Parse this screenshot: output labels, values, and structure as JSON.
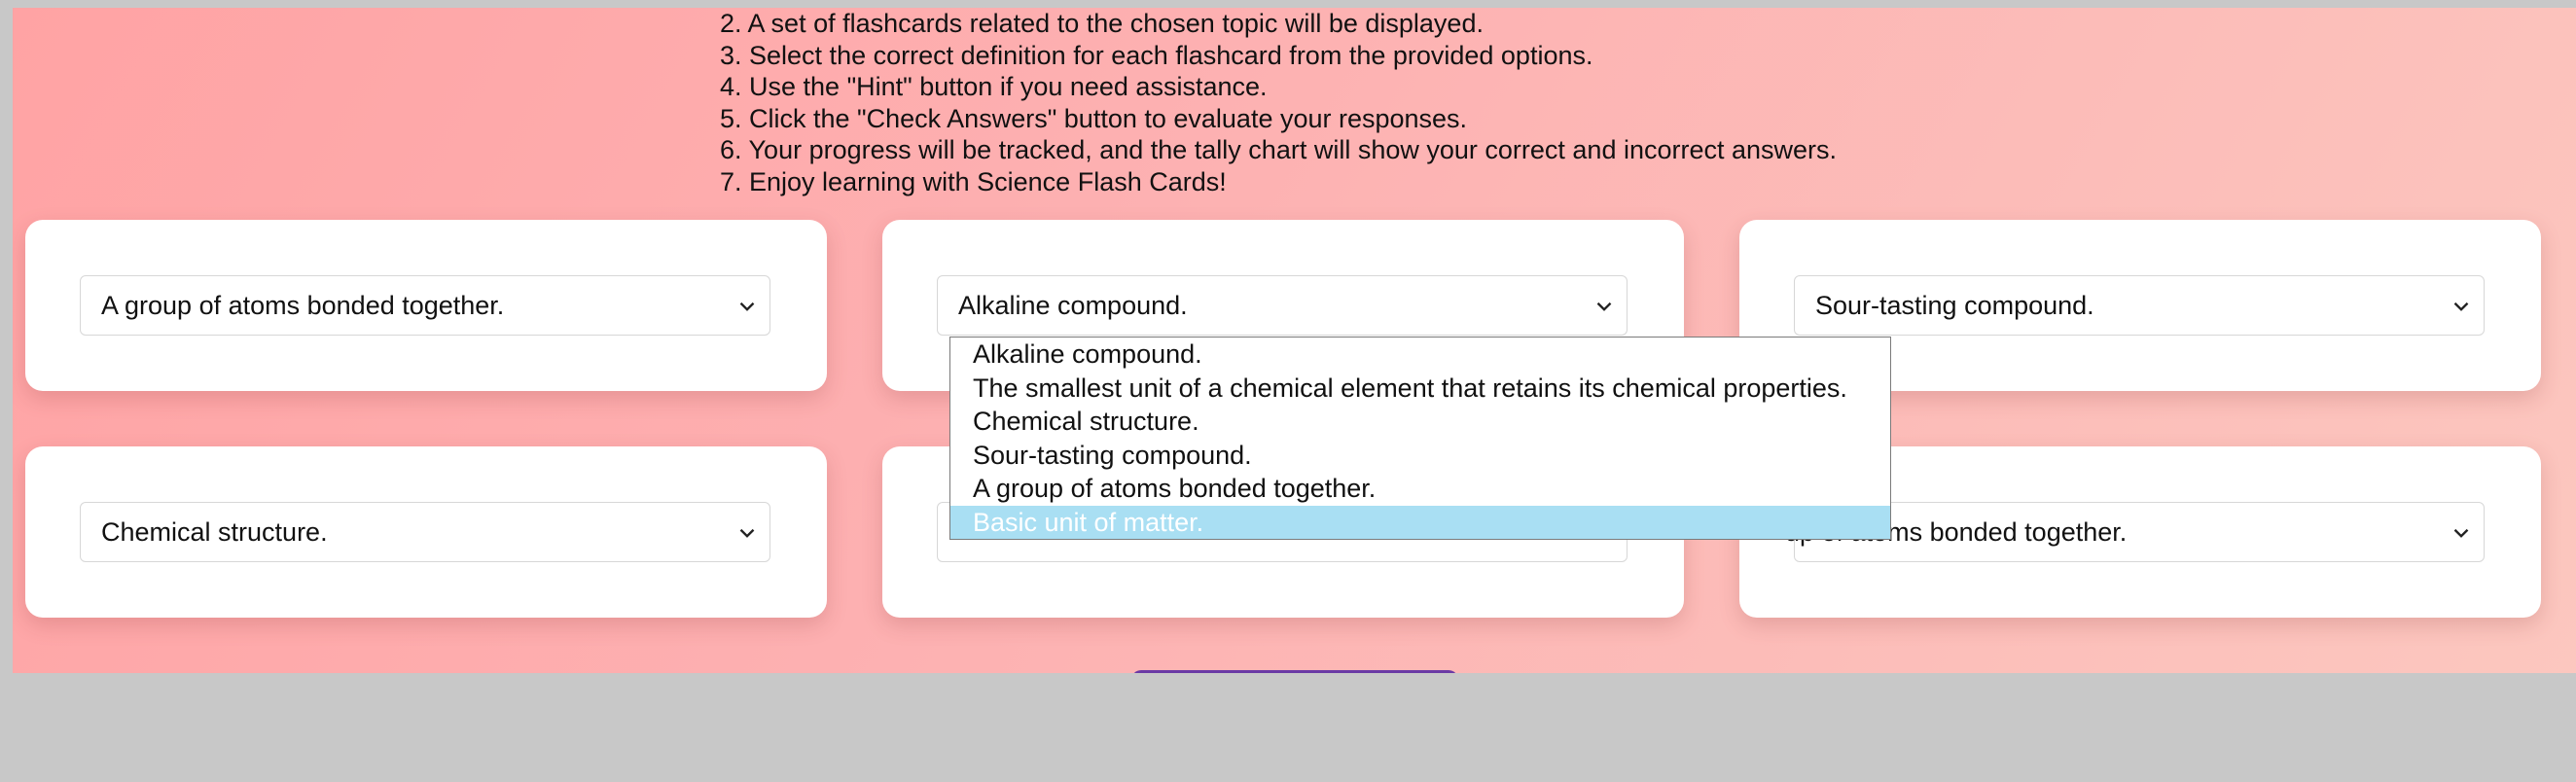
{
  "instructions": [
    "2. A set of flashcards related to the chosen topic will be displayed.",
    "3. Select the correct definition for each flashcard from the provided options.",
    "4. Use the \"Hint\" button if you need assistance.",
    "5. Click the \"Check Answers\" button to evaluate your responses.",
    "6. Your progress will be tracked, and the tally chart will show your correct and incorrect answers.",
    "7. Enjoy learning with Science Flash Cards!"
  ],
  "cards": [
    {
      "selected": "A group of atoms bonded together."
    },
    {
      "selected": "Alkaline compound."
    },
    {
      "selected": "Sour-tasting compound."
    },
    {
      "selected": "Chemical structure."
    },
    {
      "selected": ""
    },
    {
      "selected": "A group of atoms bonded together."
    }
  ],
  "card6_visible_text": "up of atoms bonded together.",
  "dropdown": {
    "options": [
      "Alkaline compound.",
      "The smallest unit of a chemical element that retains its chemical properties.",
      "Chemical structure.",
      "Sour-tasting compound.",
      "A group of atoms bonded together.",
      "Basic unit of matter."
    ],
    "highlighted_index": 5
  },
  "colors": {
    "background_gradient_start": "#ffa3a4",
    "background_gradient_end": "#fcc7bf",
    "highlight": "#a9dff3",
    "button": "#6b3aa5"
  },
  "icons": {
    "select_arrow": "chevron-down-icon"
  }
}
